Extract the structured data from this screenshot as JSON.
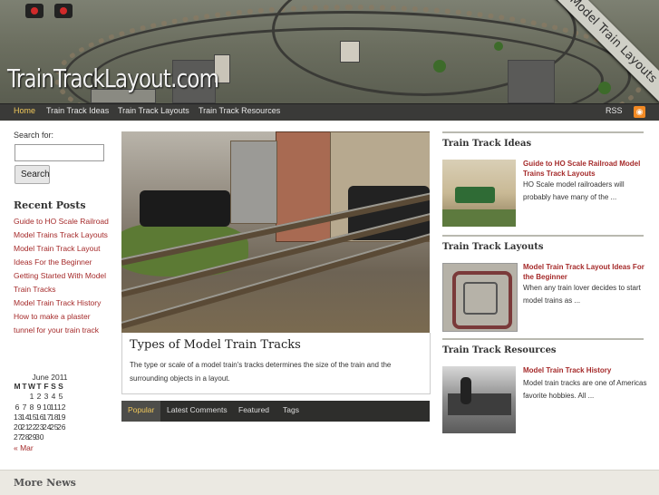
{
  "header": {
    "logo": "TrainTrackLayout.com",
    "ribbon": "Model Train Layouts"
  },
  "nav": {
    "items": [
      "Home",
      "Train Track Ideas",
      "Train Track Layouts",
      "Train Track Resources"
    ],
    "rss": "RSS"
  },
  "sidebar": {
    "search_label": "Search for:",
    "search_value": "",
    "search_button": "Search",
    "recent_title": "Recent Posts",
    "recent": [
      "Guide to HO Scale Railroad",
      "Model Trains Track Layouts",
      "Model Train Track Layout",
      "Ideas For the Beginner",
      "Getting Started With Model",
      "Train Tracks",
      "Model Train Track History",
      "How to make a plaster",
      "tunnel for your train track"
    ],
    "calendar": {
      "caption": "June 2011",
      "days": [
        "M",
        "T",
        "W",
        "T",
        "F",
        "S",
        "S"
      ],
      "rows": [
        [
          "",
          "",
          "1",
          "2",
          "3",
          "4",
          "5"
        ],
        [
          "6",
          "7",
          "8",
          "9",
          "10",
          "11",
          "12"
        ],
        [
          "13",
          "14",
          "15",
          "16",
          "17",
          "18",
          "19"
        ],
        [
          "20",
          "21",
          "22",
          "23",
          "24",
          "25",
          "26"
        ],
        [
          "27",
          "28",
          "29",
          "30",
          "",
          "",
          ""
        ]
      ],
      "prev": "« Mar"
    }
  },
  "feature": {
    "title": "Types of Model Train Tracks",
    "text": "The type or scale of a model train's tracks determines the size of the train and the surrounding objects in a layout."
  },
  "tabs": [
    "Popular",
    "Latest Comments",
    "Featured",
    "Tags"
  ],
  "right": {
    "sections": [
      {
        "title": "Train Track Ideas",
        "link": "Guide to HO Scale Railroad Model Trains Track Layouts",
        "text": "HO Scale model railroaders will probably have many of the ..."
      },
      {
        "title": "Train Track Layouts",
        "link": "Model Train Track Layout Ideas For the Beginner",
        "text": "When any train lover decides to start model trains as ..."
      },
      {
        "title": "Train Track Resources",
        "link": "Model Train Track History",
        "text": "Model train tracks are one of Americas favorite hobbies. All ..."
      }
    ]
  },
  "more_news": "More News"
}
